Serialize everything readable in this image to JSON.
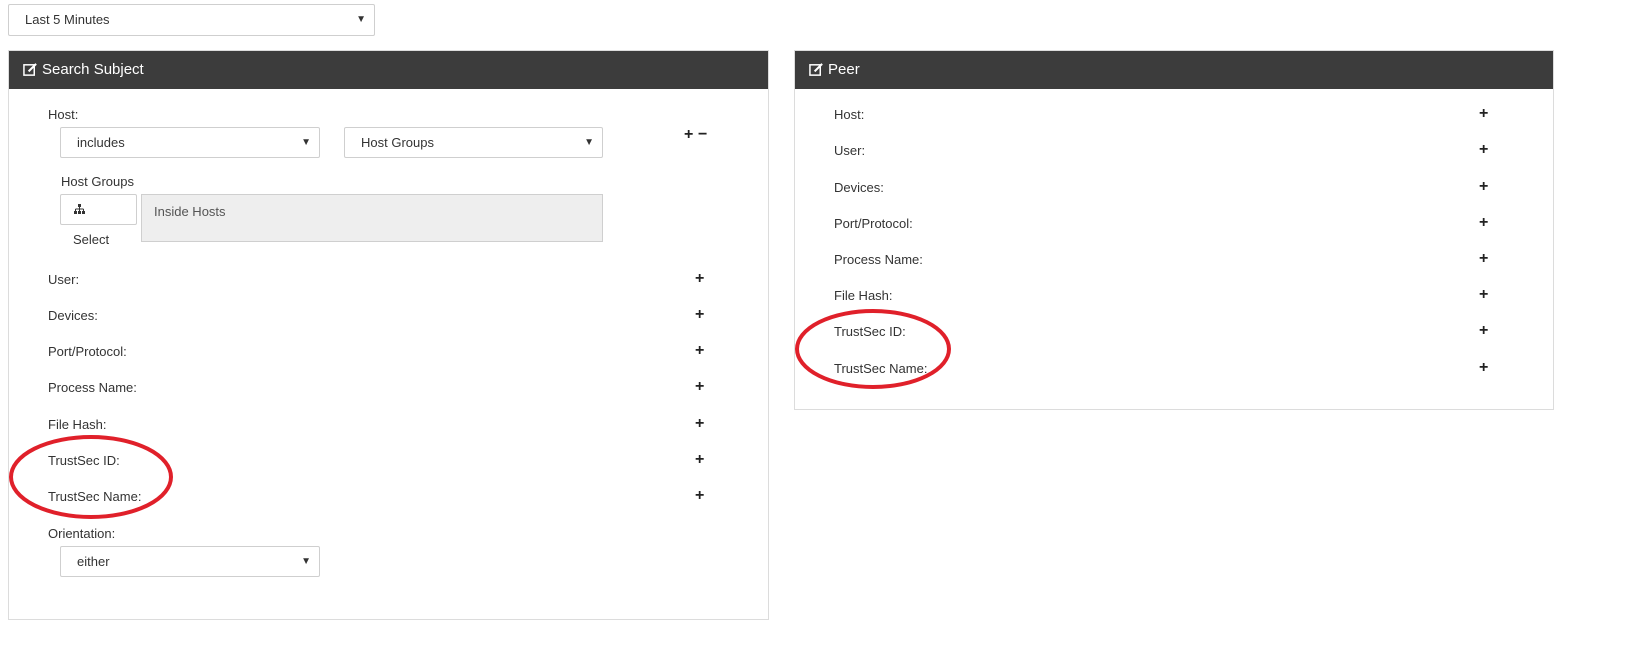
{
  "time_range": {
    "selected": "Last 5 Minutes"
  },
  "search_subject": {
    "title": "Search Subject",
    "host_label": "Host:",
    "host_operator": "includes",
    "host_type": "Host Groups",
    "host_groups_label": "Host Groups",
    "select_button": "Select",
    "host_groups_value": "Inside Hosts",
    "fields": [
      {
        "label": "User:"
      },
      {
        "label": "Devices:"
      },
      {
        "label": "Port/Protocol:"
      },
      {
        "label": "Process Name:"
      },
      {
        "label": "File Hash:"
      },
      {
        "label": "TrustSec ID:"
      },
      {
        "label": "TrustSec Name:"
      }
    ],
    "orientation_label": "Orientation:",
    "orientation_value": "either"
  },
  "peer": {
    "title": "Peer",
    "fields": [
      {
        "label": "Host:"
      },
      {
        "label": "User:"
      },
      {
        "label": "Devices:"
      },
      {
        "label": "Port/Protocol:"
      },
      {
        "label": "Process Name:"
      },
      {
        "label": "File Hash:"
      },
      {
        "label": "TrustSec ID:"
      },
      {
        "label": "TrustSec Name:"
      }
    ]
  },
  "annotation_color": "#e0202a"
}
